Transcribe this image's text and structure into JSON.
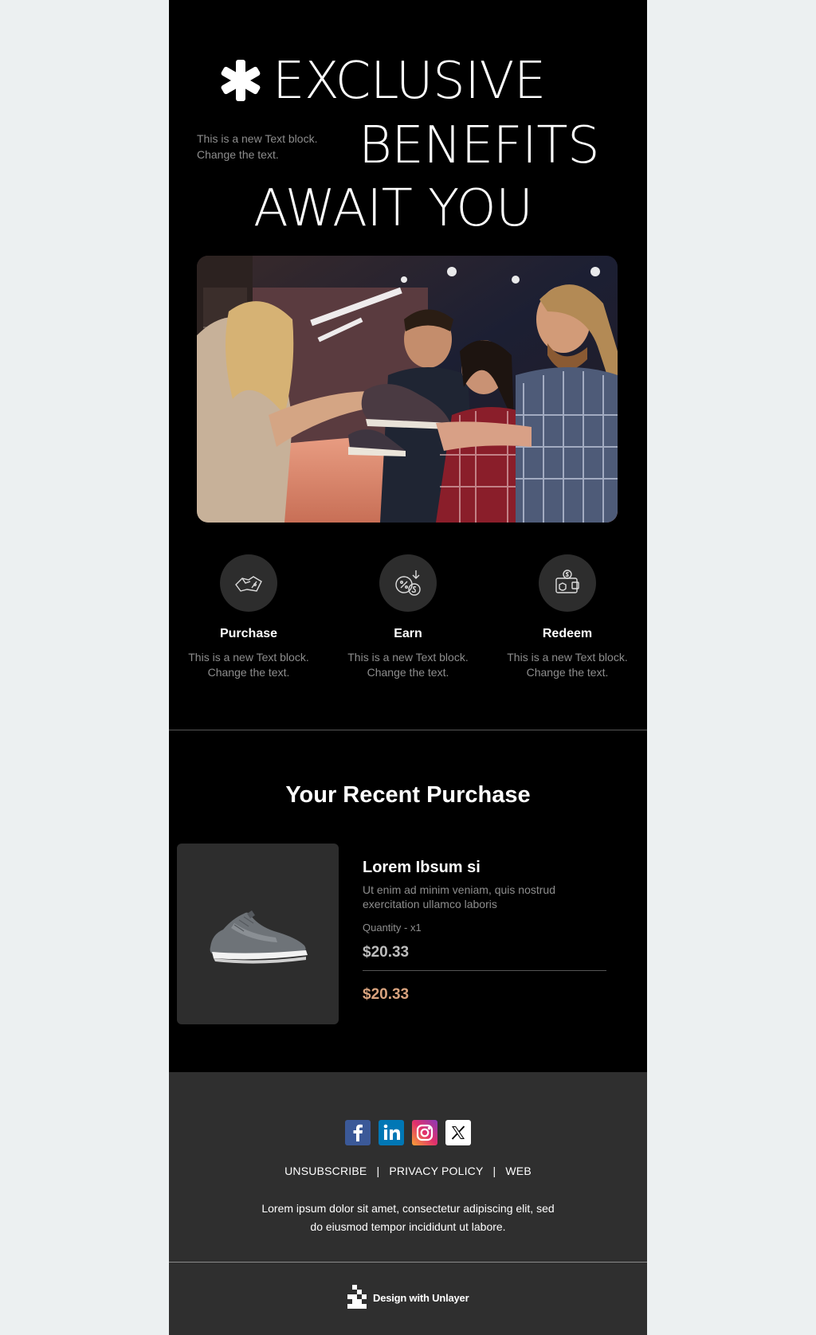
{
  "hero": {
    "line1": "EXCLUSIVE",
    "line2": "BENEFITS",
    "line3": "AWAIT YOU",
    "note_line1": "This is a new Text block.",
    "note_line2": "Change the text."
  },
  "benefits": [
    {
      "title": "Purchase",
      "text_line1": "This is a new Text block.",
      "text_line2": "Change the text.",
      "icon": "hand-tag-icon"
    },
    {
      "title": "Earn",
      "text_line1": "This is a new Text block.",
      "text_line2": "Change the text.",
      "icon": "coins-percent-icon"
    },
    {
      "title": "Redeem",
      "text_line1": "This is a new Text block.",
      "text_line2": "Change the text.",
      "icon": "wallet-icon"
    }
  ],
  "purchase": {
    "section_title": "Your Recent Purchase",
    "name": "Lorem Ibsum si",
    "description": "Ut enim ad minim veniam, quis nostrud exercitation ullamco laboris",
    "quantity": "Quantity - x1",
    "price": "$20.33",
    "total": "$20.33"
  },
  "footer": {
    "social": [
      "facebook-icon",
      "linkedin-icon",
      "instagram-icon",
      "x-icon"
    ],
    "links": {
      "unsubscribe": "UNSUBSCRIBE",
      "privacy": "PRIVACY POLICY",
      "web": "WEB",
      "separator": "|"
    },
    "text_line1": "Lorem ipsum dolor sit amet, consectetur adipiscing elit, sed",
    "text_line2": "do eiusmod tempor incididunt ut labore.",
    "badge": "Design with Unlayer"
  },
  "colors": {
    "page_bg": "#ecf0f1",
    "email_bg": "#000000",
    "card_bg": "#2d2d2d",
    "muted_text": "#8d8d8d",
    "total_accent": "#d9a37e",
    "footer_bg": "#2f2f2f"
  }
}
